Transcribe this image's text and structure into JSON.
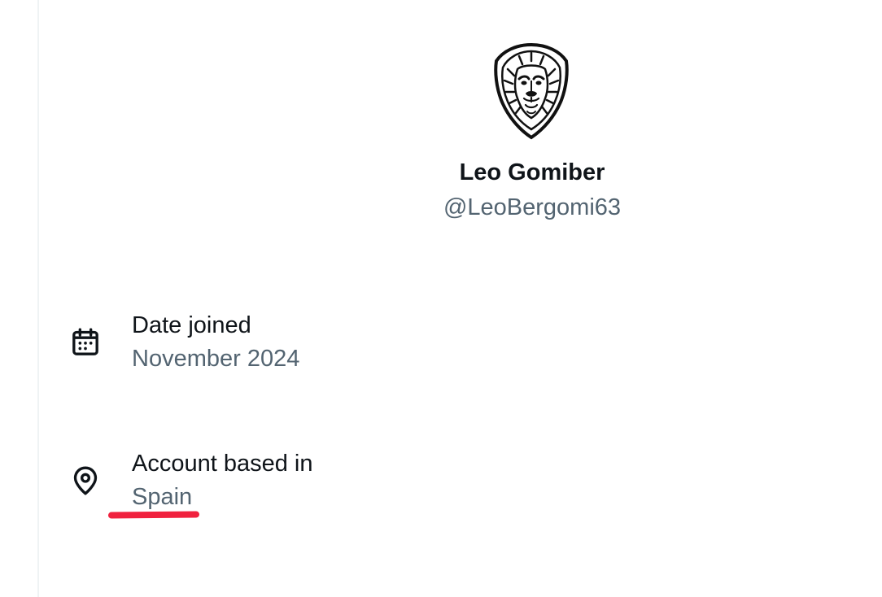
{
  "profile": {
    "display_name": "Leo Gomiber",
    "handle": "@LeoBergomi63",
    "avatar_icon": "lion-crest-icon"
  },
  "about": {
    "date_joined": {
      "icon": "calendar-icon",
      "label": "Date joined",
      "value": "November 2024"
    },
    "location": {
      "icon": "location-pin-icon",
      "label": "Account based in",
      "value": "Spain",
      "highlight_color": "#f0213e"
    }
  },
  "colors": {
    "primary_text": "#0f1419",
    "secondary_text": "#536471"
  }
}
